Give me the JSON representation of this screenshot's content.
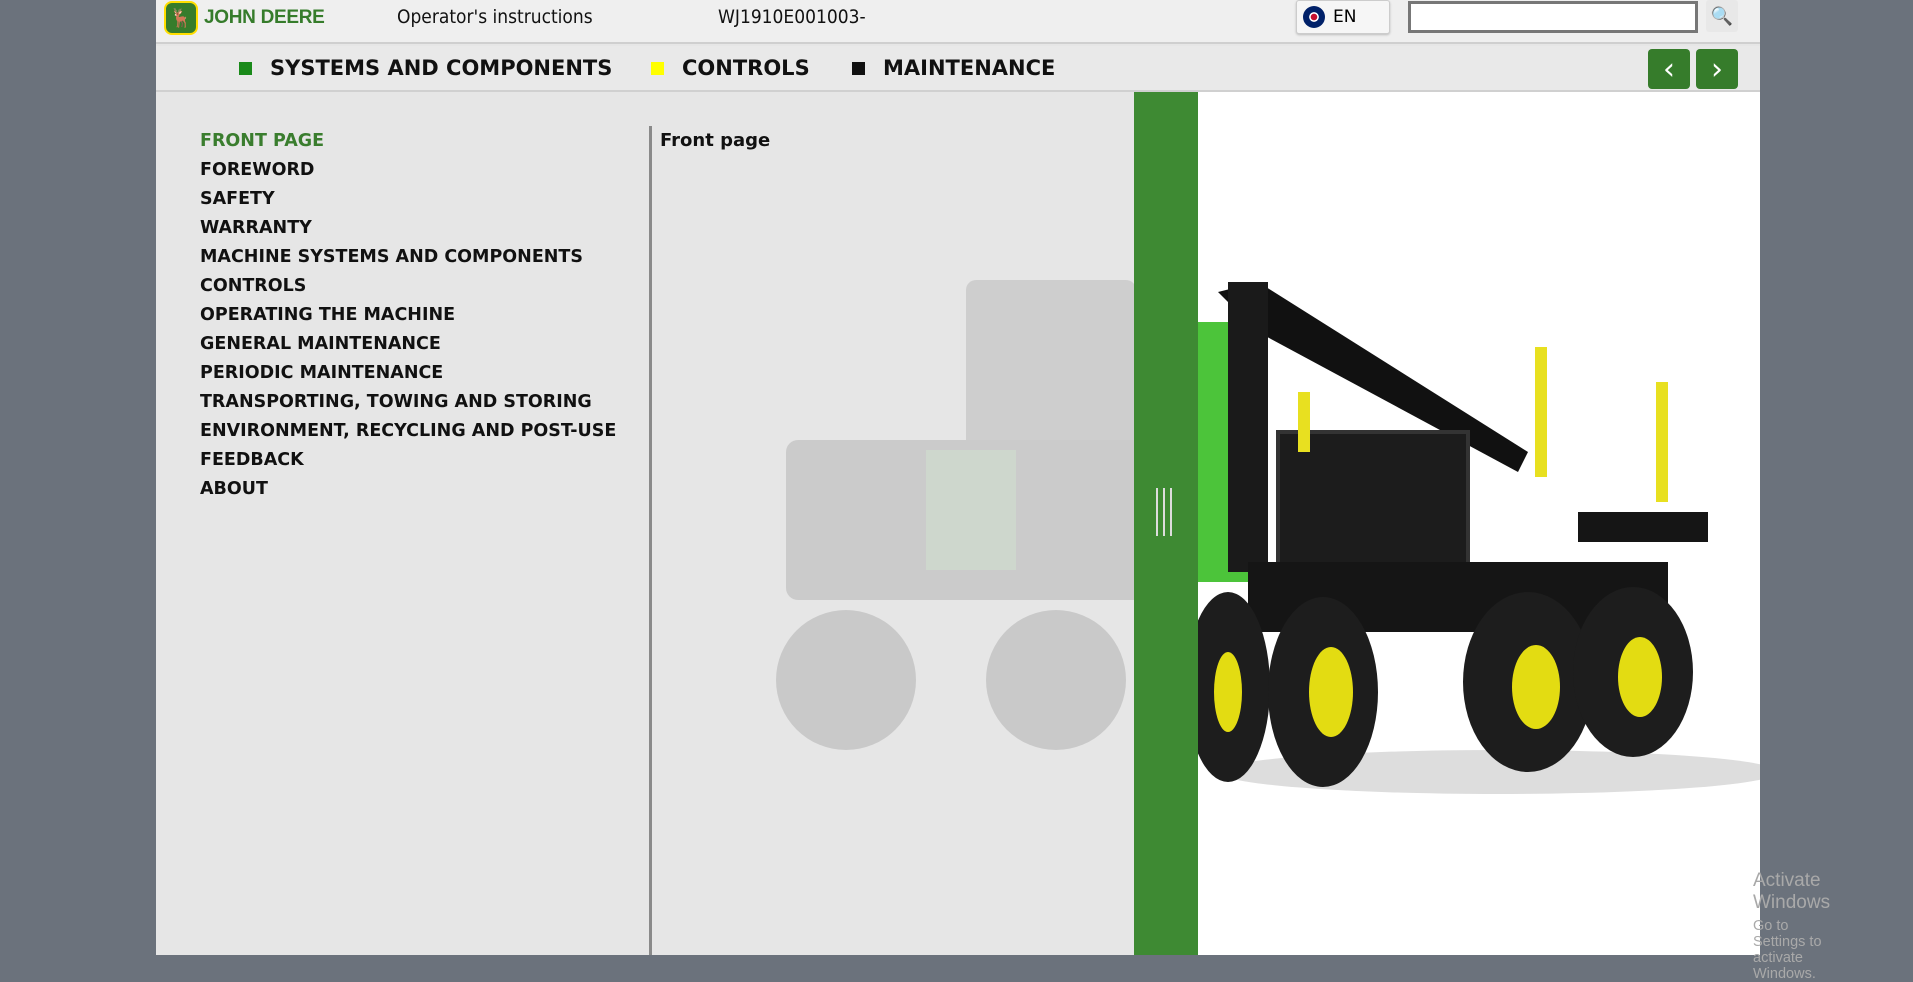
{
  "header": {
    "brand": "JOHN DEERE",
    "doc_type": "Operator's instructions",
    "doc_id": "WJ1910E001003-",
    "language": "EN",
    "search_value": "",
    "search_placeholder": ""
  },
  "nav": {
    "items": [
      {
        "label": "SYSTEMS AND COMPONENTS",
        "color": "#1a8a1a"
      },
      {
        "label": "CONTROLS",
        "color": "#ffff00"
      },
      {
        "label": "MAINTENANCE",
        "color": "#111111"
      }
    ],
    "prev": "‹",
    "next": "›"
  },
  "toc": {
    "items": [
      "FRONT PAGE",
      "FOREWORD",
      "SAFETY",
      "WARRANTY",
      "MACHINE SYSTEMS AND COMPONENTS",
      "CONTROLS",
      "OPERATING THE MACHINE",
      "GENERAL MAINTENANCE",
      "PERIODIC MAINTENANCE",
      "TRANSPORTING, TOWING AND STORING",
      "ENVIRONMENT, RECYCLING AND POST-USE",
      "FEEDBACK",
      "ABOUT"
    ],
    "active": 0
  },
  "content": {
    "title": "Front page"
  },
  "watermark": {
    "line1": "Activate Windows",
    "line2": "Go to Settings to activate Windows."
  }
}
